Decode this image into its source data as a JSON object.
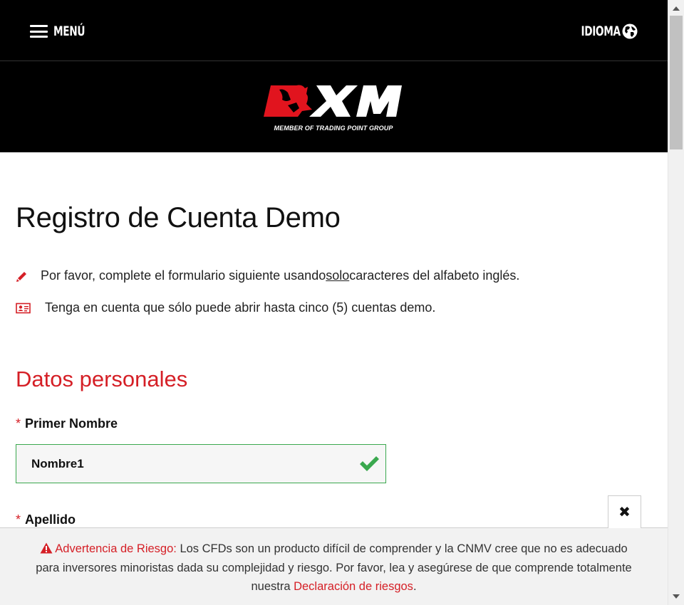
{
  "header": {
    "menu_label": "MENÚ",
    "language_label": "IDIOMA"
  },
  "logo": {
    "wordmark": "XM",
    "tagline": "MEMBER OF TRADING POINT GROUP"
  },
  "page": {
    "title": "Registro de Cuenta Demo",
    "notes": [
      {
        "icon": "pencil-icon",
        "text_before": "Por favor, complete el formulario siguiente usando ",
        "underlined": "solo",
        "text_after": " caracteres del alfabeto inglés."
      },
      {
        "icon": "id-card-icon",
        "text": "Tenga en cuenta que sólo puede abrir hasta cinco (5) cuentas demo."
      }
    ]
  },
  "personal_data": {
    "section_title": "Datos personales",
    "required_marker": "*",
    "first_name": {
      "label": "Primer Nombre",
      "value": "Nombre1",
      "status": "valid"
    },
    "last_name": {
      "label": "Apellido"
    }
  },
  "risk_warning": {
    "title": "Advertencia de Riesgo:",
    "body": " Los CFDs son un producto difícil de comprender y la CNMV cree que no es adecuado para inversores minoristas dada su complejidad y riesgo. Por favor, lea y asegúrese de que comprende totalmente nuestra ",
    "link_text": "Declaración de riesgos",
    "end": ".",
    "close_symbol": "✖"
  },
  "colors": {
    "brand_red": "#d51f26",
    "header_bg": "#000000",
    "valid_green": "#3aa84e",
    "banner_bg": "#f2f2f2"
  }
}
